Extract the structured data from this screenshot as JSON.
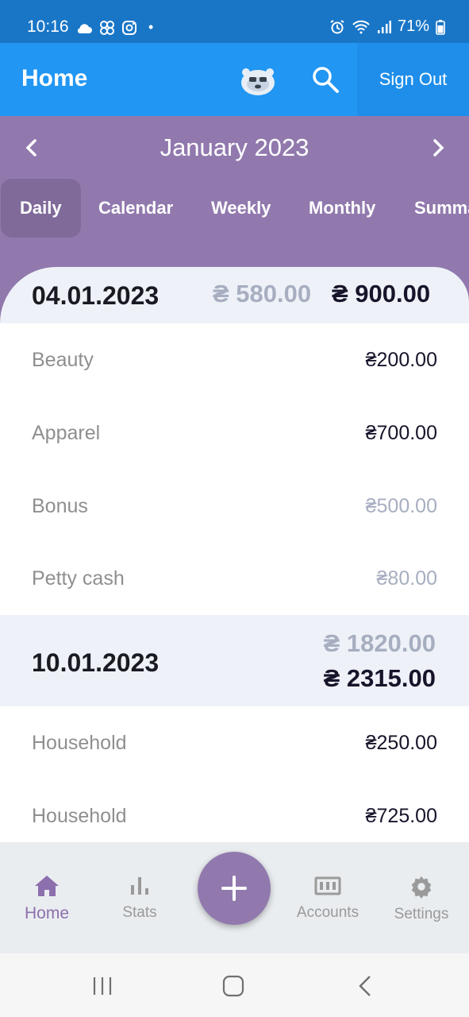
{
  "status_bar": {
    "time": "10:16",
    "dot": "•",
    "battery": "71%",
    "icons": [
      "cloud-icon",
      "pinwheel-icon",
      "instagram-icon",
      "alarm-icon",
      "wifi-icon",
      "signal-icon",
      "battery-icon"
    ]
  },
  "app_bar": {
    "title": "Home",
    "sign_out_label": "Sign Out",
    "icons": [
      "mascot-icon",
      "search-icon"
    ]
  },
  "month_nav": {
    "label": "January 2023"
  },
  "tabs": [
    {
      "label": "Daily",
      "active": true
    },
    {
      "label": "Calendar",
      "active": false
    },
    {
      "label": "Weekly",
      "active": false
    },
    {
      "label": "Monthly",
      "active": false
    },
    {
      "label": "Summa",
      "active": false
    }
  ],
  "days": [
    {
      "date": "04.01.2023",
      "income_total": "₴ 580.00",
      "expense_total": "₴ 900.00",
      "entries": [
        {
          "label": "Beauty",
          "amount": "₴200.00",
          "type": "expense"
        },
        {
          "label": "Apparel",
          "amount": "₴700.00",
          "type": "expense"
        },
        {
          "label": "Bonus",
          "amount": "₴500.00",
          "type": "income"
        },
        {
          "label": "Petty cash",
          "amount": "₴80.00",
          "type": "income"
        }
      ]
    },
    {
      "date": "10.01.2023",
      "income_total": "₴ 1820.00",
      "expense_total": "₴ 2315.00",
      "entries": [
        {
          "label": "Household",
          "amount": "₴250.00",
          "type": "expense"
        },
        {
          "label": "Household",
          "amount": "₴725.00",
          "type": "expense"
        }
      ]
    }
  ],
  "bottom_nav": {
    "items": [
      {
        "label": "Home",
        "icon": "home-icon",
        "active": true
      },
      {
        "label": "Stats",
        "icon": "stats-icon",
        "active": false
      },
      {
        "label": "Accounts",
        "icon": "accounts-icon",
        "active": false
      },
      {
        "label": "Settings",
        "icon": "gear-icon",
        "active": false
      }
    ],
    "fab_icon": "plus-icon"
  },
  "colors": {
    "app_bar": "#2196f3",
    "status_bar": "#1976c7",
    "accent_purple": "#9179ae",
    "income_gray": "#a7aec0",
    "expense_dark": "#17142a"
  }
}
